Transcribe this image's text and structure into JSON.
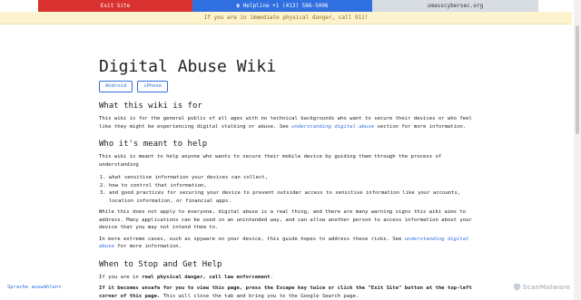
{
  "topbar": {
    "exit_label": "Exit Site",
    "helpline_label": "Helpline +1 (413) 586-5006",
    "site_label": "umasscybersec.org"
  },
  "alert": {
    "text": "If you are in immediate physical danger, call 911!"
  },
  "page": {
    "title": "Digital Abuse Wiki",
    "buttons": [
      "Android",
      "iPhone"
    ]
  },
  "sections": {
    "what_heading": "What this wiki is for",
    "what_p1_text": "This wiki is for the general public of all ages with no technical backgrounds who want to secure their devices or who feel like they might be experiencing digital stalking or abuse. See ",
    "what_p1_link": "understanding digital abuse",
    "what_p1_tail": " section for more information.",
    "who_heading": "Who it's meant to help",
    "who_p1": "This wiki is meant to help anyone who wants to secure their mobile device by guiding them through the process of understanding",
    "who_list": [
      "what sensitive information your devices can collect,",
      "how to control that information,",
      "and good practices for securing your device to prevent outsider access to sensitive information like your accounts, location information, or financial apps."
    ],
    "who_p2": "While this does not apply to everyone, digital abuse is a real thing, and there are many warning signs this wiki aims to address. Many applications can be used in an unintended way, and can allow another person to access information about your device that you may not intend them to.",
    "who_p3_text": "In more extreme cases, such as spyware on your device, this guide hopes to address these risks. See ",
    "who_p3_link": "understanding digital abuse",
    "who_p3_tail": " for more information.",
    "stop_heading": "When to Stop and Get Help",
    "stop_p1_text": "If you are in ",
    "stop_p1_bold": "real physical danger, call law enforcement",
    "stop_p1_tail": ".",
    "stop_p2_bold": "If it becomes unsafe for you to view this page, press the Escape key twice or click the \"Exit Site\" button at the top-left corner of this page.",
    "stop_p2_tail": " This will close the tab and bring you to the Google Search page."
  },
  "footer": {
    "language_label": "Sprache auswählen"
  },
  "watermark": {
    "text": "ScanMalware"
  }
}
